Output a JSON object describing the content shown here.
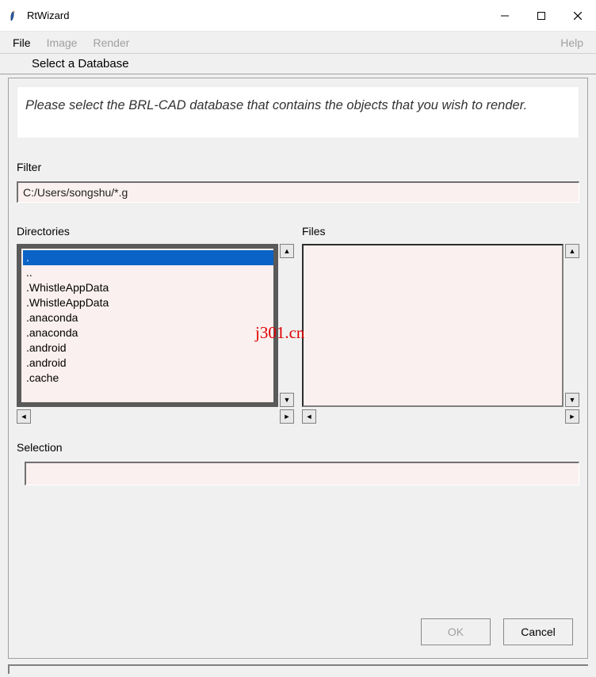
{
  "window": {
    "title": "RtWizard"
  },
  "menu": {
    "file": "File",
    "image": "Image",
    "render": "Render",
    "help": "Help"
  },
  "dialog": {
    "section_title": "Select a Database",
    "instruction": "Please select the BRL-CAD database that contains the objects that you wish to render.",
    "filter_label": "Filter",
    "filter_value": "C:/Users/songshu/*.g",
    "directories_label": "Directories",
    "files_label": "Files",
    "selection_label": "Selection",
    "selection_value": "",
    "ok_label": "OK",
    "cancel_label": "Cancel"
  },
  "directories": {
    "items": [
      ".",
      "..",
      ".WhistleAppData",
      ".WhistleAppData",
      ".anaconda",
      ".anaconda",
      ".android",
      ".android",
      ".cache"
    ],
    "selected_index": 0
  },
  "files": {
    "items": []
  },
  "watermark": "j301.cn"
}
